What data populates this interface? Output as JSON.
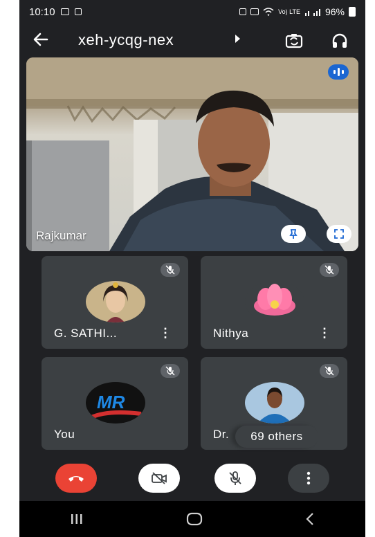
{
  "status_bar": {
    "time": "10:10",
    "signal_text": "Vo) LTE",
    "battery": "96%"
  },
  "header": {
    "meeting_code": "xeh-ycqg-nex",
    "icons": [
      "back-arrow-icon",
      "switch-camera-icon",
      "headphones-icon"
    ]
  },
  "main_video": {
    "participant_name": "Rajkumar",
    "speaking_indicator_color": "#1a66d2"
  },
  "tiles": [
    {
      "name": "G. SATHI...",
      "muted": true
    },
    {
      "name": "Nithya",
      "muted": true
    },
    {
      "name": "You",
      "muted": true
    },
    {
      "name": "Dr.",
      "muted": true
    }
  ],
  "others_pill": {
    "label": "69 others"
  },
  "controls": {
    "end_call_color": "#ea4335",
    "items": [
      "end-call-icon",
      "camera-off-icon",
      "mic-off-icon",
      "more-options-icon"
    ]
  },
  "colors": {
    "background": "#202124",
    "tile": "#3c4043",
    "accent_blue": "#1a66d2"
  }
}
